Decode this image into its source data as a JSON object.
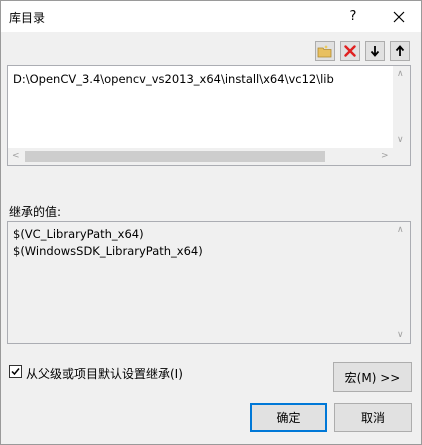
{
  "window": {
    "title": "库目录",
    "help_label": "?",
    "close_label": "✕"
  },
  "toolbar": {
    "new_icon": "new-folder-icon",
    "delete_icon": "delete-icon",
    "down_icon": "move-down-icon",
    "up_icon": "move-up-icon"
  },
  "paths": {
    "items": [
      "D:\\OpenCV_3.4\\opencv_vs2013_x64\\install\\x64\\vc12\\lib"
    ]
  },
  "inherited": {
    "label": "继承的值:",
    "items": [
      "$(VC_LibraryPath_x64)",
      "$(WindowsSDK_LibraryPath_x64)"
    ]
  },
  "options": {
    "inherit_label": "从父级或项目默认设置继承(I)",
    "inherit_checked": true
  },
  "buttons": {
    "macro": "宏(M) >>",
    "ok": "确定",
    "cancel": "取消"
  },
  "colors": {
    "delete_red": "#e02020",
    "accent": "#0078d7"
  }
}
